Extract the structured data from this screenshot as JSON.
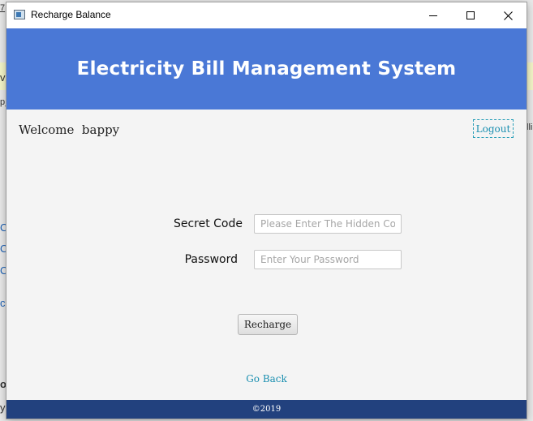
{
  "background_app": {
    "fragments": [
      "7",
      "vs",
      "p_",
      "C",
      "C",
      "C",
      "ck",
      "o",
      "y",
      "lli"
    ]
  },
  "window": {
    "title": "Recharge Balance",
    "controls": {
      "minimize_icon": "minimize-icon",
      "maximize_icon": "maximize-icon",
      "close_icon": "close-icon"
    }
  },
  "header": {
    "title": "Electricity Bill Management System",
    "background_color": "#4a78d6"
  },
  "topbar": {
    "welcome": "Welcome  bappy",
    "logout": "Logout"
  },
  "form": {
    "secret_code_label": "Secret Code",
    "secret_code_placeholder": "Please Enter The Hidden Code",
    "secret_code_value": "",
    "password_label": "Password",
    "password_placeholder": "Enter Your Password",
    "password_value": "",
    "recharge_button": "Recharge"
  },
  "go_back": "Go Back",
  "footer": {
    "text": "©2019",
    "background_color": "#22417e"
  }
}
